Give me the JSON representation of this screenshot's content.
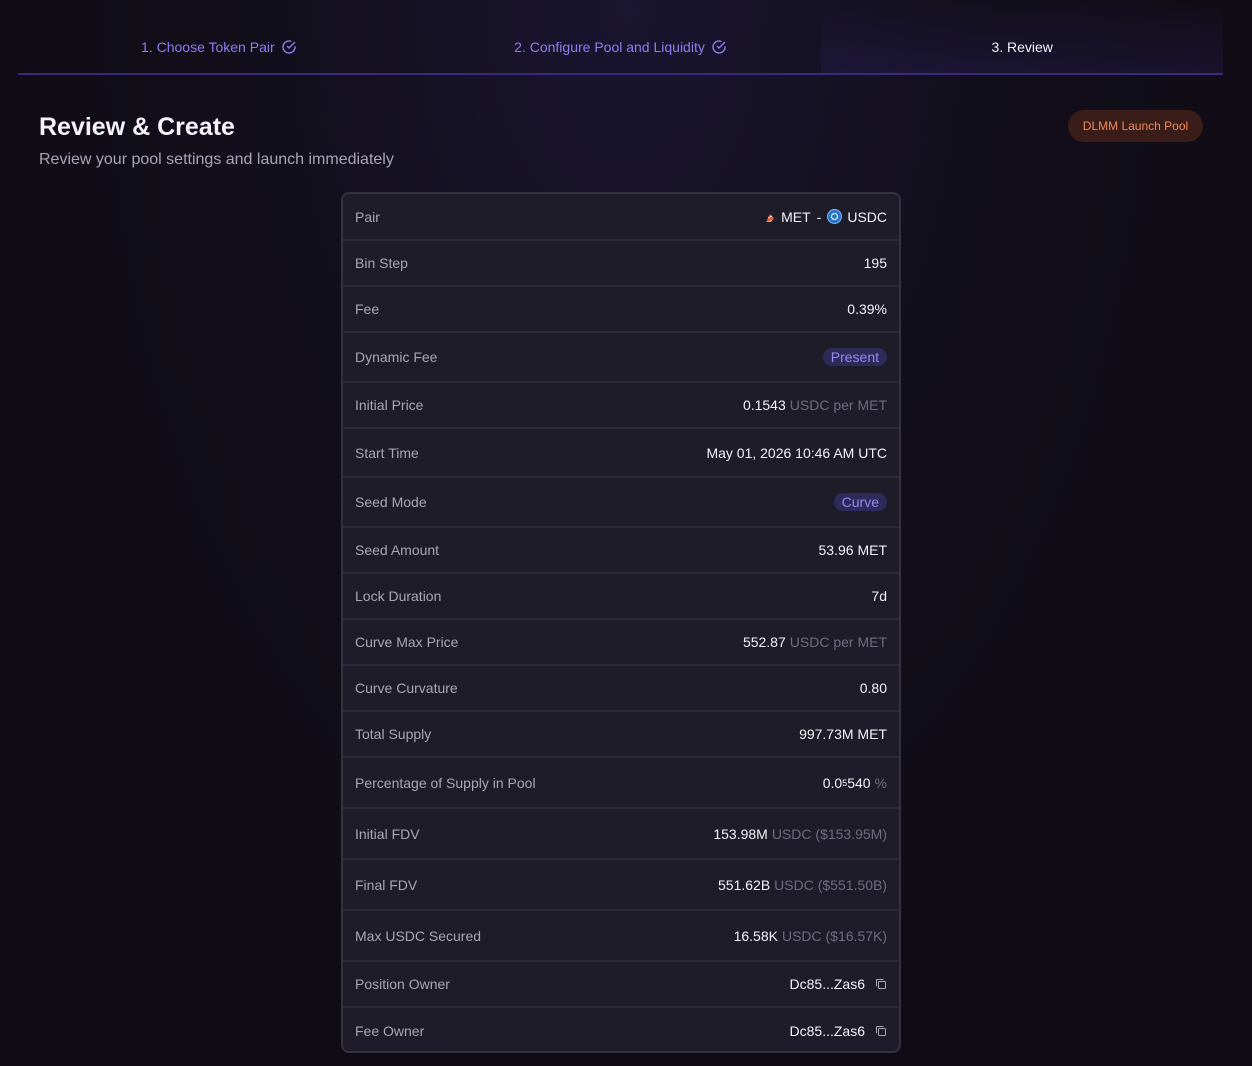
{
  "stepper": {
    "steps": [
      {
        "label": "1. Choose Token Pair",
        "state": "done"
      },
      {
        "label": "2. Configure Pool and Liquidity",
        "state": "done"
      },
      {
        "label": "3. Review",
        "state": "active"
      }
    ]
  },
  "header": {
    "title": "Review & Create",
    "subtitle": "Review your pool settings and launch immediately",
    "badge": "DLMM Launch Pool"
  },
  "review": {
    "pair": {
      "label": "Pair",
      "base": "MET",
      "separator": "-",
      "quote": "USDC"
    },
    "bin_step": {
      "label": "Bin Step",
      "value": "195"
    },
    "fee": {
      "label": "Fee",
      "value": "0.39%"
    },
    "dynamic_fee": {
      "label": "Dynamic Fee",
      "value": "Present"
    },
    "initial_price": {
      "label": "Initial Price",
      "value": "0.1543",
      "unit": "USDC per MET"
    },
    "start_time": {
      "label": "Start Time",
      "value": "May 01, 2026 10:46 AM UTC"
    },
    "seed_mode": {
      "label": "Seed Mode",
      "value": "Curve"
    },
    "seed_amount": {
      "label": "Seed Amount",
      "value": "53.96 MET"
    },
    "lock_duration": {
      "label": "Lock Duration",
      "value": "7d"
    },
    "curve_max_price": {
      "label": "Curve Max Price",
      "value": "552.87",
      "unit": "USDC per MET"
    },
    "curve_curvature": {
      "label": "Curve Curvature",
      "value": "0.80"
    },
    "total_supply": {
      "label": "Total Supply",
      "value": "997.73M MET"
    },
    "pct_supply": {
      "label": "Percentage of Supply in Pool",
      "prefix": "0.0",
      "zeros": "5",
      "digits": "540",
      "unit": "%"
    },
    "initial_fdv": {
      "label": "Initial FDV",
      "value": "153.98M",
      "unit": "USDC ($153.95M)"
    },
    "final_fdv": {
      "label": "Final FDV",
      "value": "551.62B",
      "unit": "USDC ($551.50B)"
    },
    "max_usdc": {
      "label": "Max USDC Secured",
      "value": "16.58K",
      "unit": "USDC ($16.57K)"
    },
    "position_owner": {
      "label": "Position Owner",
      "value": "Dc85...Zas6"
    },
    "fee_owner": {
      "label": "Fee Owner",
      "value": "Dc85...Zas6"
    }
  },
  "colors": {
    "accent": "#8f7df0",
    "badge_text": "#f08a5a",
    "badge_bg": "#3a1c18",
    "usdc_blue": "#2775ca"
  },
  "icons": {
    "step_done": "check-circle-icon",
    "copy": "copy-icon",
    "met_token": "met-token-icon",
    "usdc_token": "usdc-token-icon"
  }
}
